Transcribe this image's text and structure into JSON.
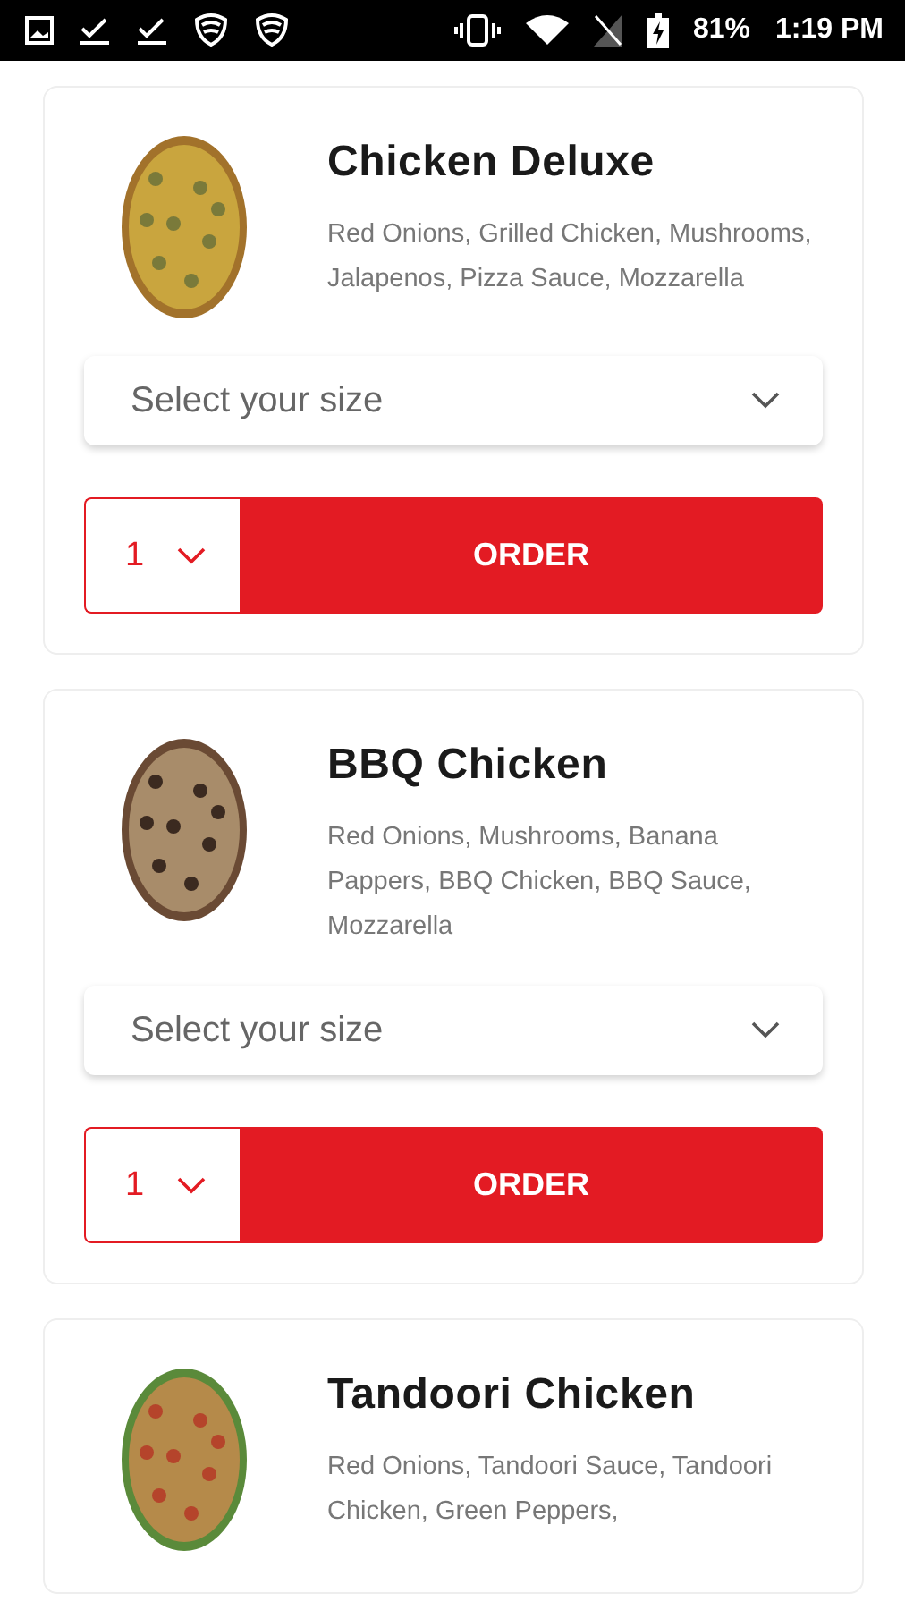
{
  "status_bar": {
    "battery": "81%",
    "time": "1:19 PM"
  },
  "items": [
    {
      "name": "Chicken Deluxe",
      "description": "Red Onions, Grilled Chicken, Mushrooms, Jalapenos, Pizza Sauce, Mozzarella",
      "size_placeholder": "Select your size",
      "quantity": "1",
      "order_label": "ORDER"
    },
    {
      "name": "BBQ Chicken",
      "description": "Red Onions, Mushrooms, Banana Pappers, BBQ Chicken, BBQ Sauce, Mozzarella",
      "size_placeholder": "Select your size",
      "quantity": "1",
      "order_label": "ORDER"
    },
    {
      "name": "Tandoori Chicken",
      "description": "Red Onions, Tandoori Sauce, Tandoori Chicken, Green Peppers,"
    }
  ]
}
